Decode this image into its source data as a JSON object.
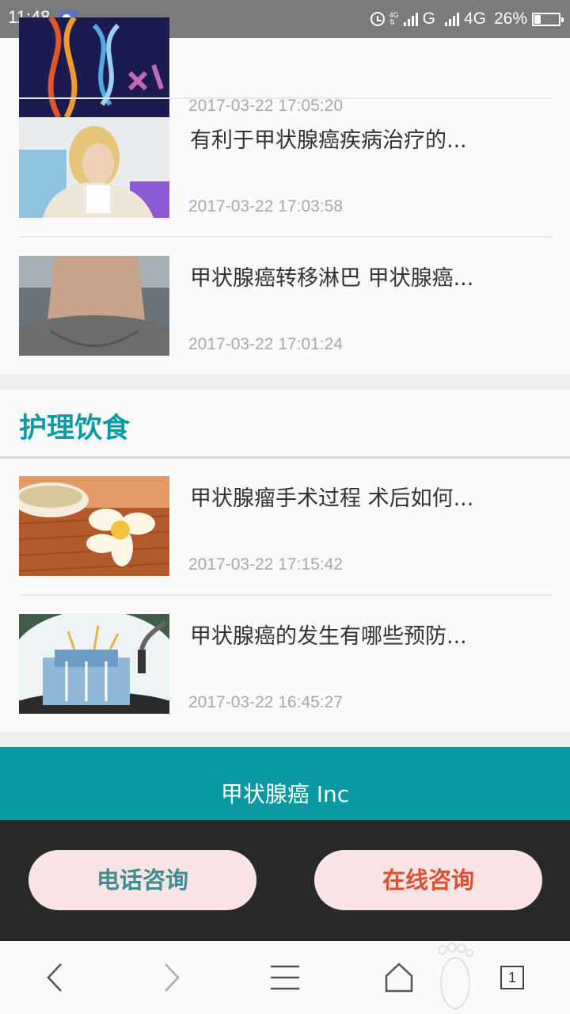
{
  "status_bar": {
    "time": "11:48",
    "network_1": "G",
    "network_2": "4G",
    "battery": "26%"
  },
  "articles_top": [
    {
      "title": "",
      "date": "2017-03-22 17:05:20",
      "image": "dna-helix"
    },
    {
      "title": "有利于甲状腺癌疾病治疗的...",
      "date": "2017-03-22 17:03:58",
      "image": "woman-with-tissue"
    },
    {
      "title": "甲状腺癌转移淋巴 甲状腺癌...",
      "date": "2017-03-22 17:01:24",
      "image": "neck"
    }
  ],
  "section": {
    "title": "护理饮食",
    "articles": [
      {
        "title": "甲状腺瘤手术过程 术后如何...",
        "date": "2017-03-22 17:15:42",
        "image": "flower-and-bowl"
      },
      {
        "title": "甲状腺癌的发生有哪些预防...",
        "date": "2017-03-22 16:45:27",
        "image": "cancer-factory"
      }
    ]
  },
  "footer": {
    "text": "甲状腺癌 Inc"
  },
  "consult": {
    "phone_label": "电话咨询",
    "online_label": "在线咨询"
  },
  "browser_nav": {
    "tab_count": "1"
  },
  "colors": {
    "accent": "#0899a3",
    "section_title": "#0e9aa4",
    "online": "#e0502d",
    "phone": "#3d8f8f"
  }
}
